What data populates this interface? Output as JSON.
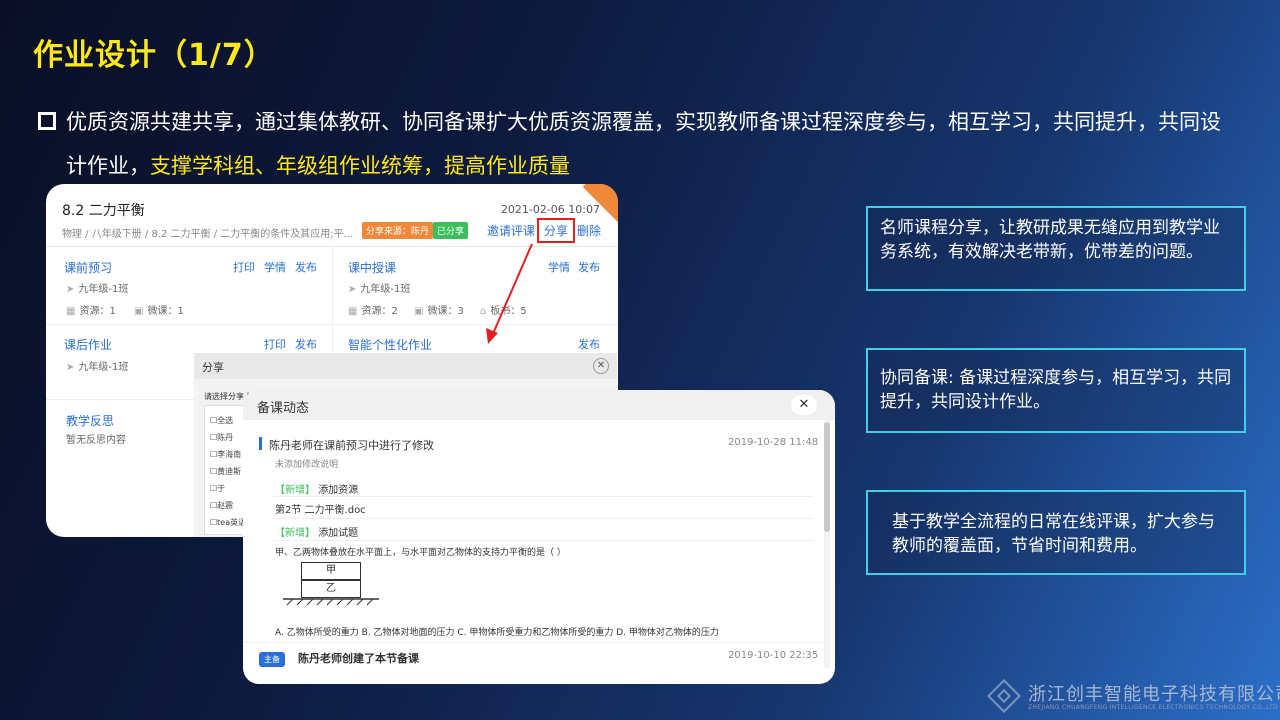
{
  "slide": {
    "title": "作业设计（1/7）",
    "bullet_main": "优质资源共建共享，通过集体教研、协同备课扩大优质资源覆盖，实现教师备课过程深度参与，相互学习，共同提升，共同设计作业，",
    "bullet_highlight": "支撑学科组、年级组作业统筹，提高作业质量"
  },
  "panel1": {
    "title": "8.2 二力平衡",
    "date": "2021-02-06 10:07",
    "breadcrumb": "物理 / 八年级下册 / 8.2 二力平衡 / 二力平衡的条件及其应用;平...",
    "tag_source": "分享来源：陈丹",
    "tag_shared": "已分享",
    "action_invite": "邀请评课",
    "action_share": "分享",
    "action_delete": "删除",
    "card_preclass": {
      "title": "课前预习",
      "print": "打印",
      "study": "学情",
      "publish": "发布",
      "class": "九年级-1班",
      "resources": "资源：1",
      "micro": "微课：1"
    },
    "card_inclass": {
      "title": "课中授课",
      "study": "学情",
      "publish": "发布",
      "class": "九年级-1班",
      "resources": "资源：2",
      "micro": "微课：3",
      "board": "板书：5"
    },
    "card_homework": {
      "title": "课后作业",
      "print": "打印",
      "publish": "发布",
      "class": "九年级-1班"
    },
    "card_smart": {
      "title": "智能个性化作业",
      "publish": "发布"
    },
    "card_reflect": {
      "title": "教学反思",
      "empty": "暂无反思内容"
    }
  },
  "share": {
    "title": "分享",
    "close": "✕",
    "prompt": "请选择分享人员",
    "options": [
      "☐全选",
      "☐陈丹",
      "☐李海南",
      "☐黄迪斯",
      "☐于",
      "☐赵震",
      "☐tea英语"
    ]
  },
  "panel2": {
    "title": "备课动态",
    "close": "✕",
    "entry1_title": "陈丹老师在课前预习中进行了修改",
    "entry1_time": "2019-10-28 11:48",
    "entry1_note": "未添加修改说明",
    "new_tag": "【新增】",
    "add_resource": "添加资源",
    "resource_file": "第2节 二力平衡.doc",
    "add_question": "添加试题",
    "question": "甲、乙两物体叠放在水平面上，与水平面对乙物体的支持力平衡的是（   ）",
    "block_top": "甲",
    "block_bottom": "乙",
    "options": "A. 乙物体所受的重力 B. 乙物体对地面的压力 C. 甲物体所受重力和乙物体所受的重力 D. 甲物体对乙物体的压力",
    "badge": "主备",
    "entry2_title": "陈丹老师创建了本节备课",
    "entry2_time": "2019-10-10 22:35"
  },
  "infoboxes": {
    "box1": "名师课程分享，让教研成果无缝应用到教学业务系统，有效解决老带新，优带差的问题。",
    "box2": "协同备课: 备课过程深度参与，相互学习，共同提升，共同设计作业。",
    "box3": "基于教学全流程的日常在线评课，扩大参与教师的覆盖面，节省时间和费用。"
  },
  "logo": {
    "cn": "浙江创丰智能电子科技有限公司",
    "en": "ZHEJIANG CHUANGFENG INTELLIGENCE ELECTRONICS TECHNOLOGY CO.,LTD"
  },
  "colors": {
    "accent_yellow": "#ffe81a",
    "box_border": "#3fd0e6",
    "link_blue": "#2a6fd6",
    "tag_orange": "#f0883a",
    "tag_green": "#3cbf5a",
    "highlight_red": "#e02020"
  }
}
